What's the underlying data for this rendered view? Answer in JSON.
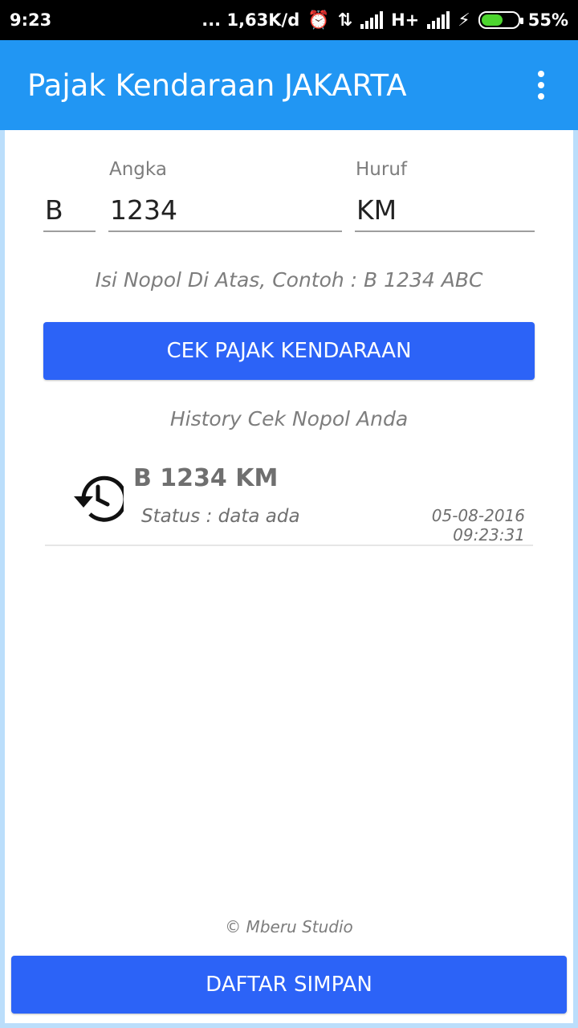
{
  "status_bar": {
    "time": "9:23",
    "network_speed": "... 1,63K/d",
    "alarm_icon": "alarm-clock-icon",
    "data_icon": "data-transfer-icon",
    "network_type": "H+",
    "battery_percent": "55%"
  },
  "app_bar": {
    "title": "Pajak Kendaraan JAKARTA",
    "menu_icon": "overflow-menu-icon"
  },
  "form": {
    "prefix_value": "B",
    "angka_label": "Angka",
    "angka_value": "1234",
    "huruf_label": "Huruf",
    "huruf_value": "KM",
    "hint": "Isi Nopol Di Atas, Contoh : B 1234 ABC",
    "submit_label": "CEK PAJAK KENDARAAN"
  },
  "history": {
    "title": "History Cek Nopol Anda",
    "items": [
      {
        "plate": "B 1234 KM",
        "status": "Status : data ada",
        "date": "05-08-2016",
        "time": "09:23:31",
        "icon": "history-icon"
      }
    ]
  },
  "footer": {
    "copyright": "© Mberu Studio",
    "saved_list_label": "DAFTAR SIMPAN"
  },
  "colors": {
    "app_bar": "#2196F3",
    "button": "#2C63F7",
    "border": "#BBDEFB",
    "battery": "#4CD52E"
  }
}
